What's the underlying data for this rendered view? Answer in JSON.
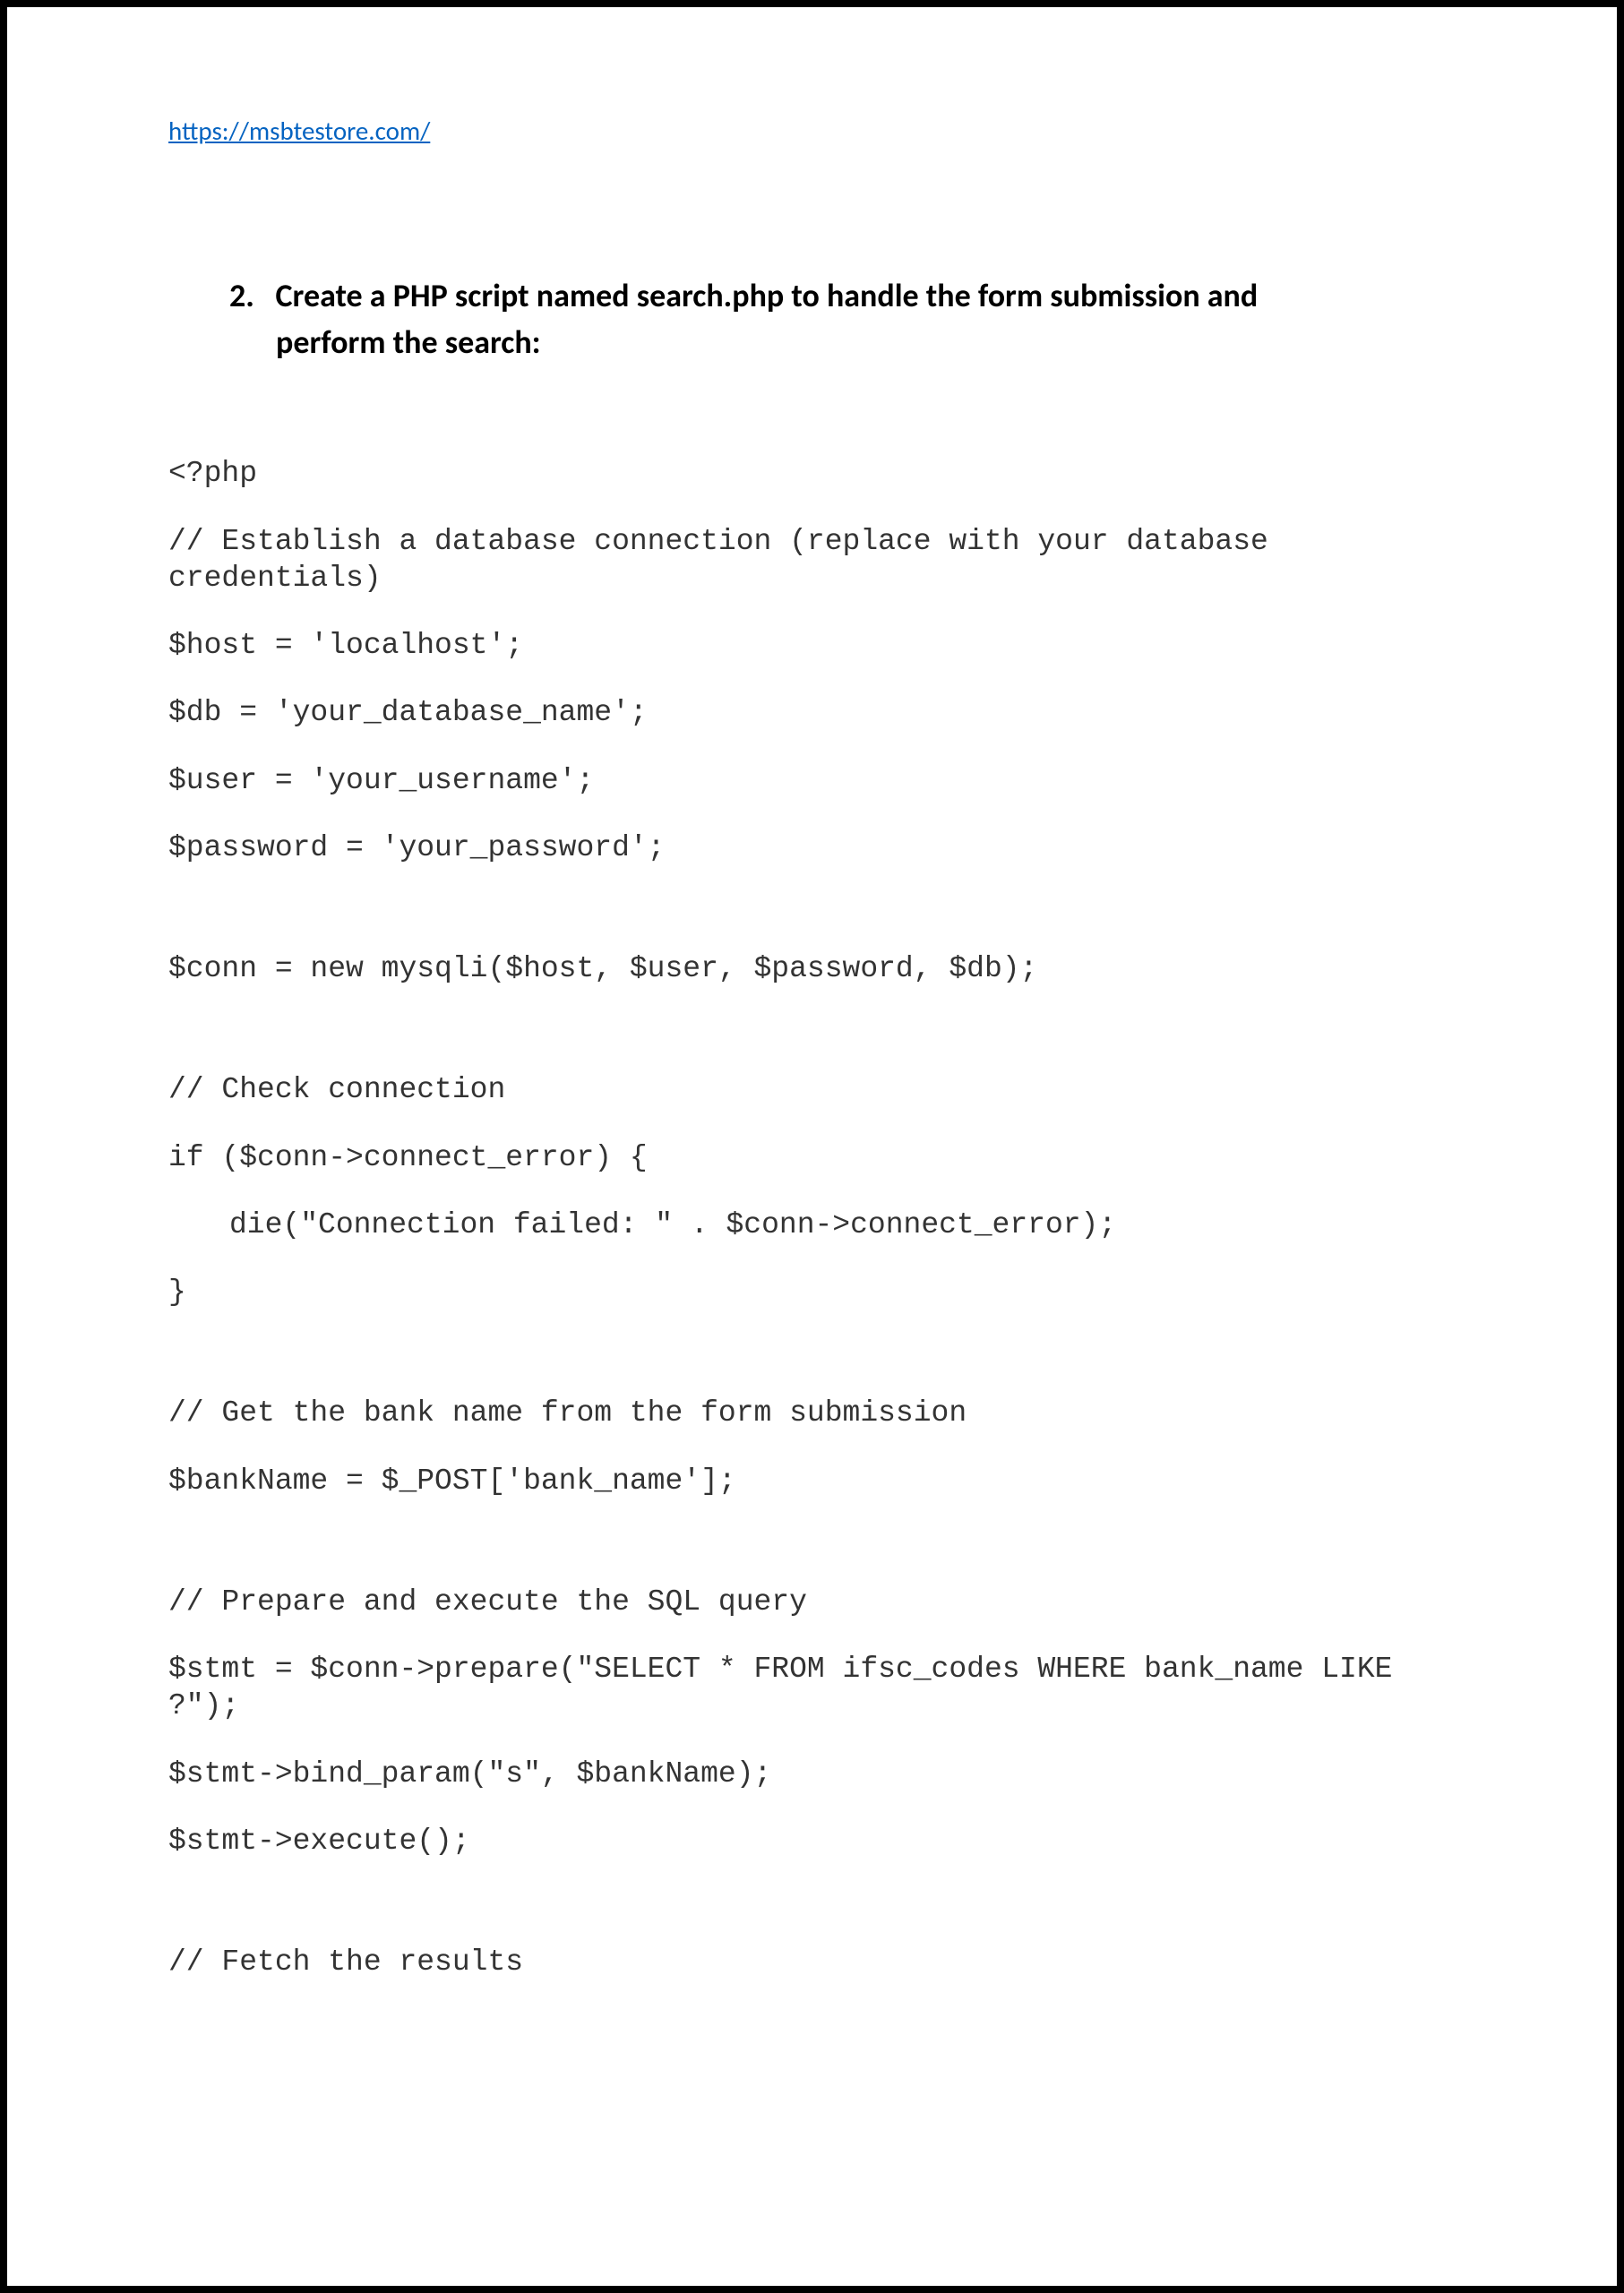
{
  "header": {
    "url": "https://msbtestore.com/"
  },
  "heading": {
    "number": "2.",
    "text_line1": "Create a PHP script named search.php to handle the form submission and",
    "text_line2": "perform the search:"
  },
  "code": {
    "l1": "<?php",
    "l2": "// Establish a database connection (replace with your database credentials)",
    "l3": "$host = 'localhost';",
    "l4": "$db = 'your_database_name';",
    "l5": "$user = 'your_username';",
    "l6": "$password = 'your_password';",
    "l7": "$conn = new mysqli($host, $user, $password, $db);",
    "l8": "// Check connection",
    "l9": "if ($conn->connect_error) {",
    "l10": "die(\"Connection failed: \" . $conn->connect_error);",
    "l11": "}",
    "l12": "// Get the bank name from the form submission",
    "l13": "$bankName = $_POST['bank_name'];",
    "l14": "// Prepare and execute the SQL query",
    "l15": "$stmt = $conn->prepare(\"SELECT * FROM ifsc_codes WHERE bank_name LIKE ?\");",
    "l16": "$stmt->bind_param(\"s\", $bankName);",
    "l17": "$stmt->execute();",
    "l18": "// Fetch the results"
  }
}
